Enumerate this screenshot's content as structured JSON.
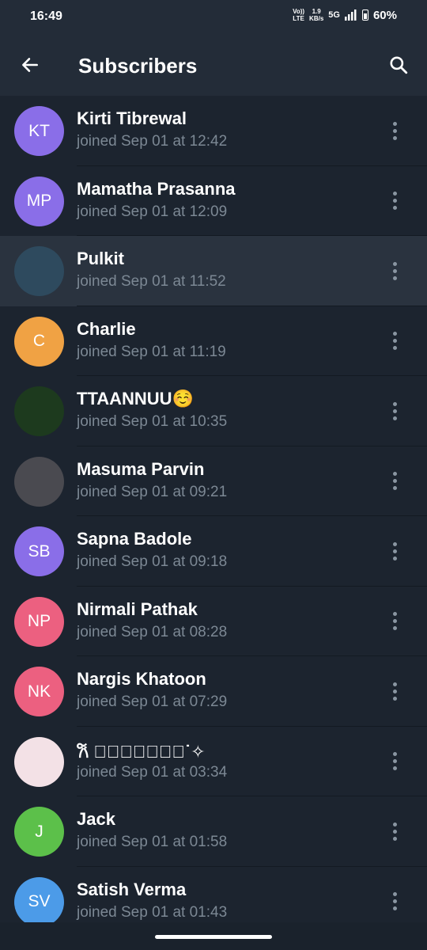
{
  "status": {
    "time": "16:49",
    "volte_top": "Vo))",
    "volte_bottom": "LTE",
    "speed_top": "1.9",
    "speed_bottom": "KB/s",
    "network": "5G",
    "battery": "60%"
  },
  "header": {
    "title": "Subscribers",
    "back_icon": "arrow-left-icon",
    "search_icon": "search-icon"
  },
  "subscribers": [
    {
      "name": "Kirti Tibrewal",
      "joined": "joined Sep 01 at 12:42",
      "initials": "KT",
      "color": "#8a6ee8"
    },
    {
      "name": "Mamatha Prasanna",
      "joined": "joined Sep 01 at 12:09",
      "initials": "MP",
      "color": "#8a6ee8"
    },
    {
      "name": "Pulkit",
      "joined": "joined Sep 01 at 11:52",
      "initials": "",
      "color": "#2e4a5e"
    },
    {
      "name": "Charlie",
      "joined": "joined Sep 01 at 11:19",
      "initials": "C",
      "color": "#f0a244"
    },
    {
      "name": "TTAANNUU☺️",
      "joined": "joined Sep 01 at 10:35",
      "initials": "",
      "color": "#1d3a1e"
    },
    {
      "name": "Masuma Parvin",
      "joined": "joined Sep 01 at 09:21",
      "initials": "",
      "color": "#4a4a50"
    },
    {
      "name": "Sapna Badole",
      "joined": "joined Sep 01 at 09:18",
      "initials": "SB",
      "color": "#8a6ee8"
    },
    {
      "name": "Nirmali Pathak",
      "joined": "joined Sep 01 at 08:28",
      "initials": "NP",
      "color": "#ec6080"
    },
    {
      "name": "Nargis Khatoon",
      "joined": "joined Sep 01 at 07:29",
      "initials": "NK",
      "color": "#ec6080"
    },
    {
      "name": "𐙚 ⃝𝙎𝙪𝙢𝙞𝙧𝙚˙✧",
      "joined": "joined Sep 01 at 03:34",
      "initials": "",
      "color": "#f3e1e6"
    },
    {
      "name": "Jack",
      "joined": "joined Sep 01 at 01:58",
      "initials": "J",
      "color": "#5cc04a"
    },
    {
      "name": "Satish Verma",
      "joined": "joined Sep 01 at 01:43",
      "initials": "SV",
      "color": "#4c9be8"
    }
  ]
}
